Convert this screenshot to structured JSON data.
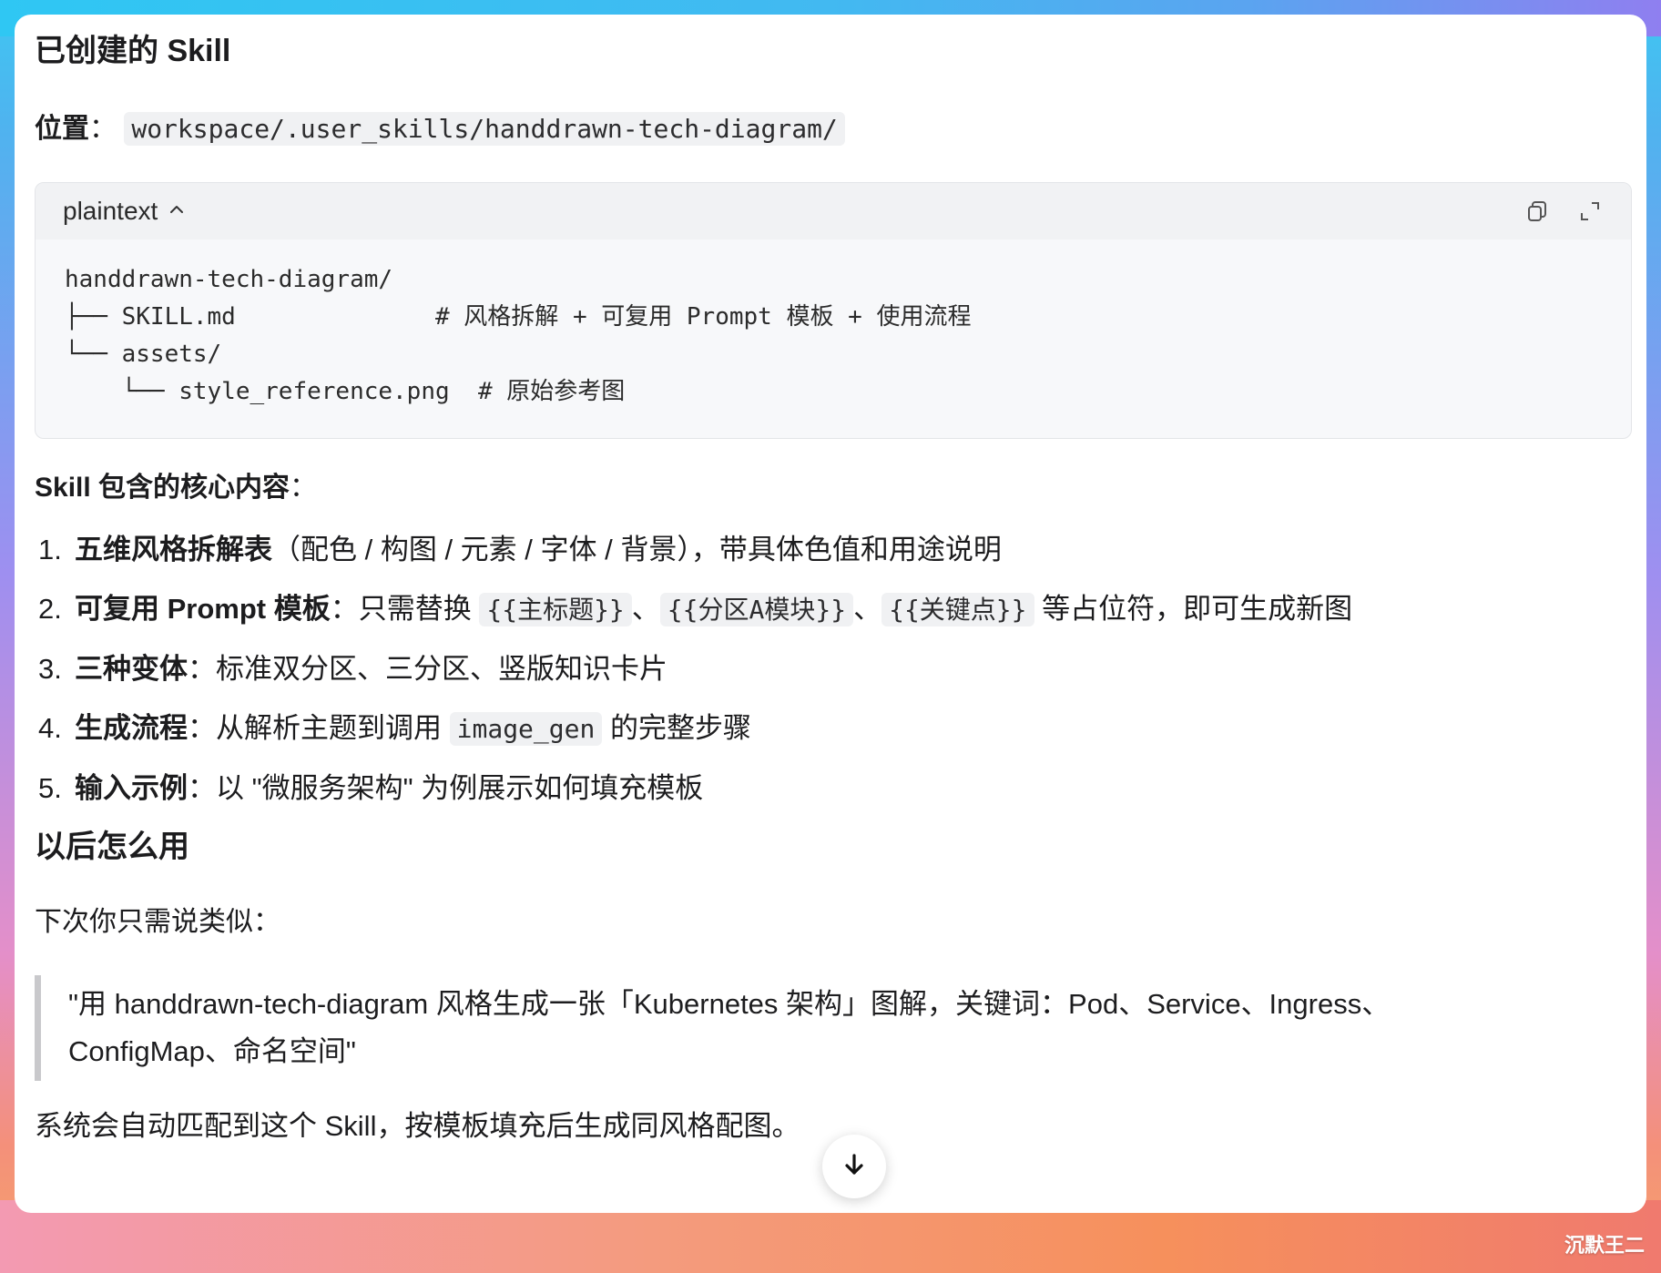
{
  "title": "已创建的 Skill",
  "location": {
    "label": "位置",
    "sep": "：",
    "path": "workspace/.user_skills/handdrawn-tech-diagram/"
  },
  "codeblock": {
    "lang": "plaintext",
    "lines": [
      "handdrawn-tech-diagram/",
      "├── SKILL.md              # 风格拆解 + 可复用 Prompt 模板 + 使用流程",
      "└── assets/",
      "    └── style_reference.png  # 原始参考图"
    ]
  },
  "core": {
    "heading": "Skill 包含的核心内容",
    "sep": "：",
    "items": [
      {
        "num": "1.",
        "bold": "五维风格拆解表",
        "text": "（配色 / 构图 / 元素 / 字体 / 背景），带具体色值和用途说明"
      },
      {
        "num": "2.",
        "bold": "可复用 Prompt 模板",
        "sep": "：",
        "pre": "只需替换 ",
        "code1": "{{主标题}}",
        "mid1": "、",
        "code2": "{{分区A模块}}",
        "mid2": "、",
        "code3": "{{关键点}}",
        "post": " 等占位符，即可生成新图"
      },
      {
        "num": "3.",
        "bold": "三种变体",
        "text": "：标准双分区、三分区、竖版知识卡片"
      },
      {
        "num": "4.",
        "bold": "生成流程",
        "sep": "：",
        "pre": "从解析主题到调用 ",
        "code": "image_gen",
        "post": " 的完整步骤"
      },
      {
        "num": "5.",
        "bold": "输入示例",
        "text": "：以 \"微服务架构\" 为例展示如何填充模板"
      }
    ]
  },
  "later": {
    "heading": "以后怎么用",
    "intro": "下次你只需说类似：",
    "quote_line1": "\"用 handdrawn-tech-diagram 风格生成一张「Kubernetes 架构」图解，关键词：Pod、Service、Ingress、",
    "quote_line2": "ConfigMap、命名空间\"",
    "outro": "系统会自动匹配到这个 Skill，按模板填充后生成同风格配图。"
  },
  "watermark": "沉默王二",
  "icons": {
    "chevron": "chevron-up-icon",
    "copy": "copy-icon",
    "expand": "expand-icon",
    "scroll": "arrow-down-icon"
  }
}
